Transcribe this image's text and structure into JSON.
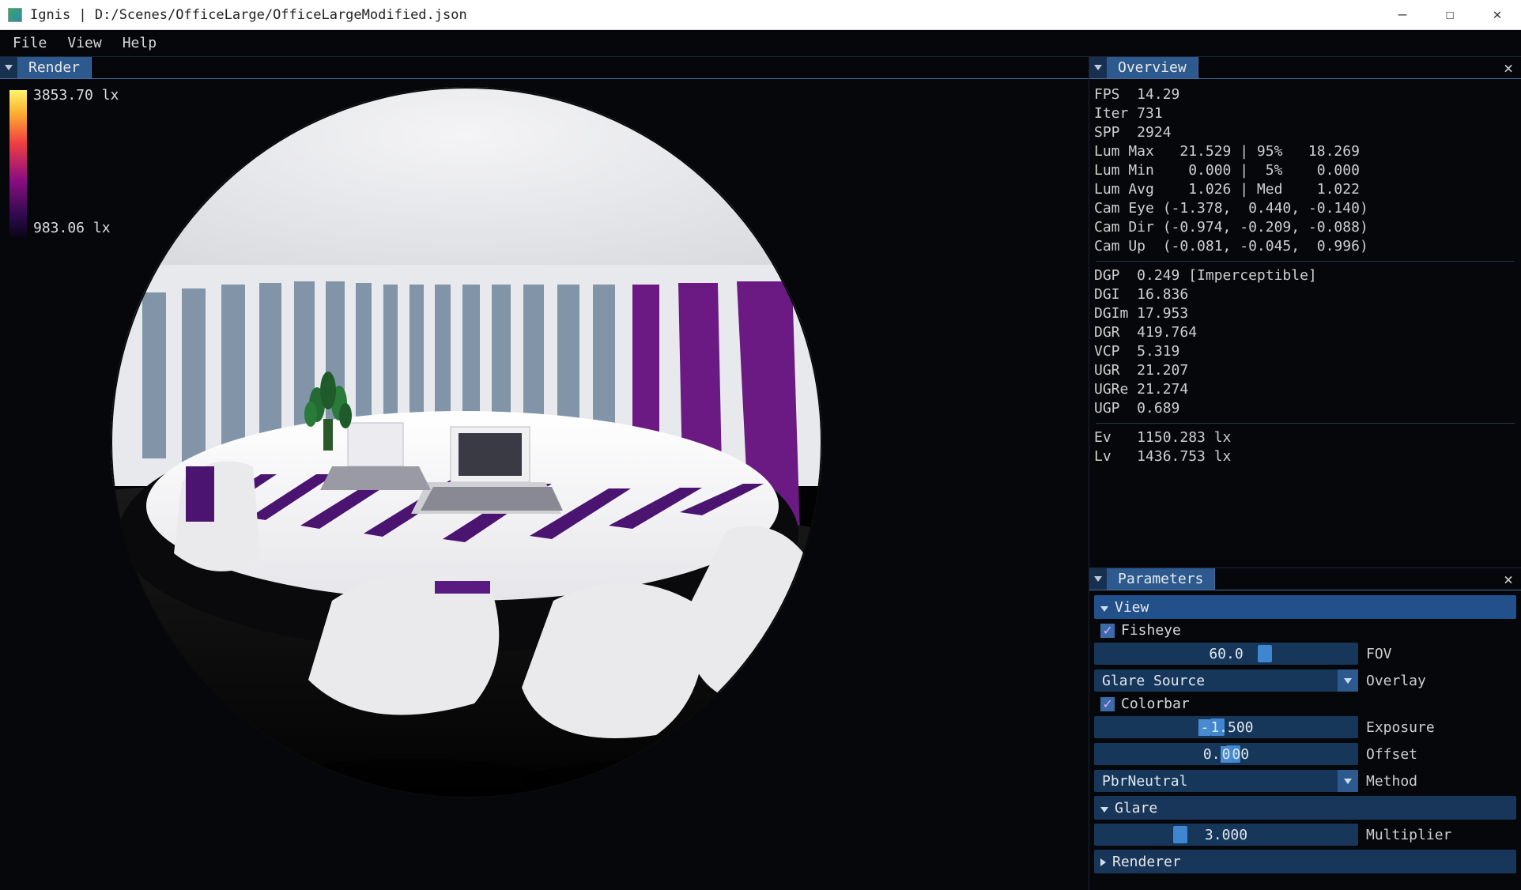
{
  "titlebar": {
    "app_name": "Ignis",
    "file_path": "D:/Scenes/OfficeLarge/OfficeLargeModified.json"
  },
  "menu": {
    "file": "File",
    "view": "View",
    "help": "Help"
  },
  "render_panel": {
    "title": "Render"
  },
  "colorbar": {
    "max": "3853.70 lx",
    "min": "983.06 lx"
  },
  "overview": {
    "title": "Overview",
    "stats": "FPS  14.29\nIter 731\nSPP  2924\nLum Max   21.529 | 95%   18.269\nLum Min    0.000 |  5%    0.000\nLum Avg    1.026 | Med    1.022\nCam Eye (-1.378,  0.440, -0.140)\nCam Dir (-0.974, -0.209, -0.088)\nCam Up  (-0.081, -0.045,  0.996)",
    "glare": "DGP  0.249 [Imperceptible]\nDGI  16.836\nDGIm 17.953\nDGR  419.764\nVCP  5.319\nUGR  21.207\nUGRe 21.274\nUGP  0.689",
    "lux": "Ev   1150.283 lx\nLv   1436.753 lx"
  },
  "params": {
    "title": "Parameters",
    "view_header": "View",
    "fisheye_label": "Fisheye",
    "fov_value": "60.0",
    "fov_label": "FOV",
    "overlay_select": "Glare Source",
    "overlay_label": "Overlay",
    "colorbar_label": "Colorbar",
    "exposure_value": "-1.500",
    "exposure_label": "Exposure",
    "offset_value": "0.000",
    "offset_label": "Offset",
    "method_select": "PbrNeutral",
    "method_label": "Method",
    "glare_header": "Glare",
    "multiplier_value": "3.000",
    "multiplier_label": "Multiplier",
    "renderer_header": "Renderer"
  }
}
